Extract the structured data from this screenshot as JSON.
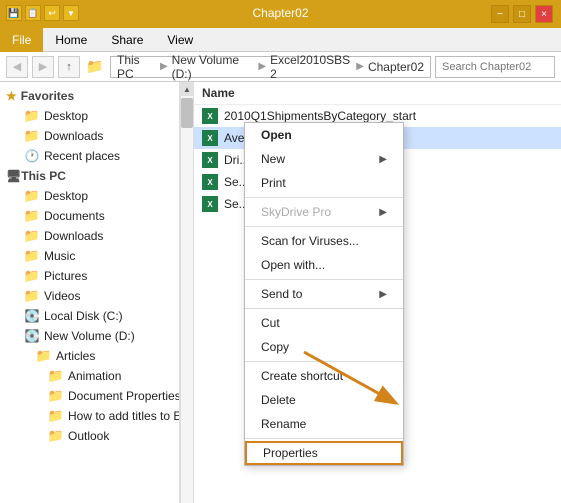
{
  "titleBar": {
    "title": "Chapter02",
    "minLabel": "−",
    "maxLabel": "□",
    "closeLabel": "×",
    "quickAccessIcons": [
      "📁",
      "📋",
      "↩"
    ]
  },
  "ribbon": {
    "tabs": [
      {
        "label": "File",
        "active": true
      },
      {
        "label": "Home",
        "active": false
      },
      {
        "label": "Share",
        "active": false
      },
      {
        "label": "View",
        "active": false
      }
    ]
  },
  "addressBar": {
    "backLabel": "◀",
    "forwardLabel": "▶",
    "upLabel": "↑",
    "pathParts": [
      "This PC",
      "New Volume (D:)",
      "Excel2010SBS 2",
      "Chapter02"
    ],
    "searchPlaceholder": "Search Chapter02"
  },
  "sidebar": {
    "favoritesLabel": "Favorites",
    "favorites": [
      {
        "label": "Desktop"
      },
      {
        "label": "Downloads"
      },
      {
        "label": "Recent places"
      }
    ],
    "thisPcLabel": "This PC",
    "thisPcItems": [
      {
        "label": "Desktop"
      },
      {
        "label": "Documents"
      },
      {
        "label": "Downloads"
      },
      {
        "label": "Music"
      },
      {
        "label": "Pictures"
      },
      {
        "label": "Videos"
      },
      {
        "label": "Local Disk (C:)"
      },
      {
        "label": "New Volume (D:)"
      }
    ],
    "newVolumeChildren": [
      {
        "label": "Articles",
        "children": [
          {
            "label": "Animation"
          },
          {
            "label": "Document Properties in Excel"
          },
          {
            "label": "How to add titles to Excel charts"
          },
          {
            "label": "Outlook"
          }
        ]
      }
    ]
  },
  "fileList": {
    "columnHeader": "Name",
    "files": [
      {
        "name": "2010Q1ShipmentsByCategory_start",
        "selected": false
      },
      {
        "name": "AverageDeliveries_start",
        "selected": true
      },
      {
        "name": "Dri...",
        "selected": false
      },
      {
        "name": "Se...",
        "selected": false
      },
      {
        "name": "Se...",
        "selected": false
      }
    ]
  },
  "contextMenu": {
    "items": [
      {
        "label": "Open",
        "type": "item",
        "bold": true
      },
      {
        "label": "New",
        "type": "item",
        "arrow": true
      },
      {
        "label": "Print",
        "type": "item"
      },
      {
        "type": "divider"
      },
      {
        "label": "SkyDrive Pro",
        "type": "item",
        "arrow": true,
        "disabled": true
      },
      {
        "type": "divider"
      },
      {
        "label": "Scan for Viruses...",
        "type": "item"
      },
      {
        "label": "Open with...",
        "type": "item"
      },
      {
        "type": "divider"
      },
      {
        "label": "Send to",
        "type": "item",
        "arrow": true
      },
      {
        "type": "divider"
      },
      {
        "label": "Cut",
        "type": "item"
      },
      {
        "label": "Copy",
        "type": "item"
      },
      {
        "type": "divider"
      },
      {
        "label": "Create shortcut",
        "type": "item"
      },
      {
        "label": "Delete",
        "type": "item"
      },
      {
        "label": "Rename",
        "type": "item"
      },
      {
        "type": "divider"
      },
      {
        "label": "Properties",
        "type": "item",
        "highlighted": true
      }
    ]
  },
  "arrow": {
    "label": "→"
  }
}
